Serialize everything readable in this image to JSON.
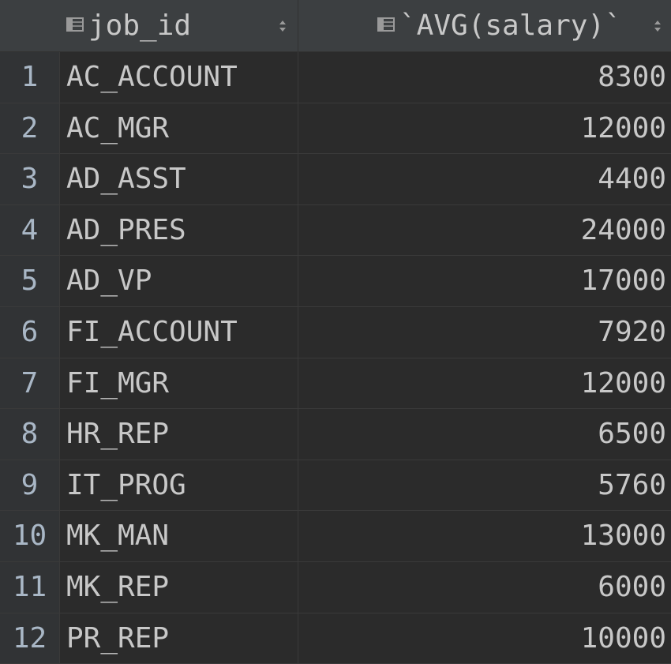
{
  "columns": [
    {
      "label": "job_id",
      "icon": "table-column-icon"
    },
    {
      "label": "`AVG(salary)`",
      "icon": "table-column-icon"
    }
  ],
  "rows": [
    {
      "num": "1",
      "job_id": "AC_ACCOUNT",
      "avg": "8300"
    },
    {
      "num": "2",
      "job_id": "AC_MGR",
      "avg": "12000"
    },
    {
      "num": "3",
      "job_id": "AD_ASST",
      "avg": "4400"
    },
    {
      "num": "4",
      "job_id": "AD_PRES",
      "avg": "24000"
    },
    {
      "num": "5",
      "job_id": "AD_VP",
      "avg": "17000"
    },
    {
      "num": "6",
      "job_id": "FI_ACCOUNT",
      "avg": "7920"
    },
    {
      "num": "7",
      "job_id": "FI_MGR",
      "avg": "12000"
    },
    {
      "num": "8",
      "job_id": "HR_REP",
      "avg": "6500"
    },
    {
      "num": "9",
      "job_id": "IT_PROG",
      "avg": "5760"
    },
    {
      "num": "10",
      "job_id": "MK_MAN",
      "avg": "13000"
    },
    {
      "num": "11",
      "job_id": "MK_REP",
      "avg": "6000"
    },
    {
      "num": "12",
      "job_id": "PR_REP",
      "avg": "10000"
    }
  ],
  "colors": {
    "background": "#2b2b2b",
    "header": "#3c3f41",
    "gutter": "#313335",
    "text": "#c8c8c8"
  }
}
